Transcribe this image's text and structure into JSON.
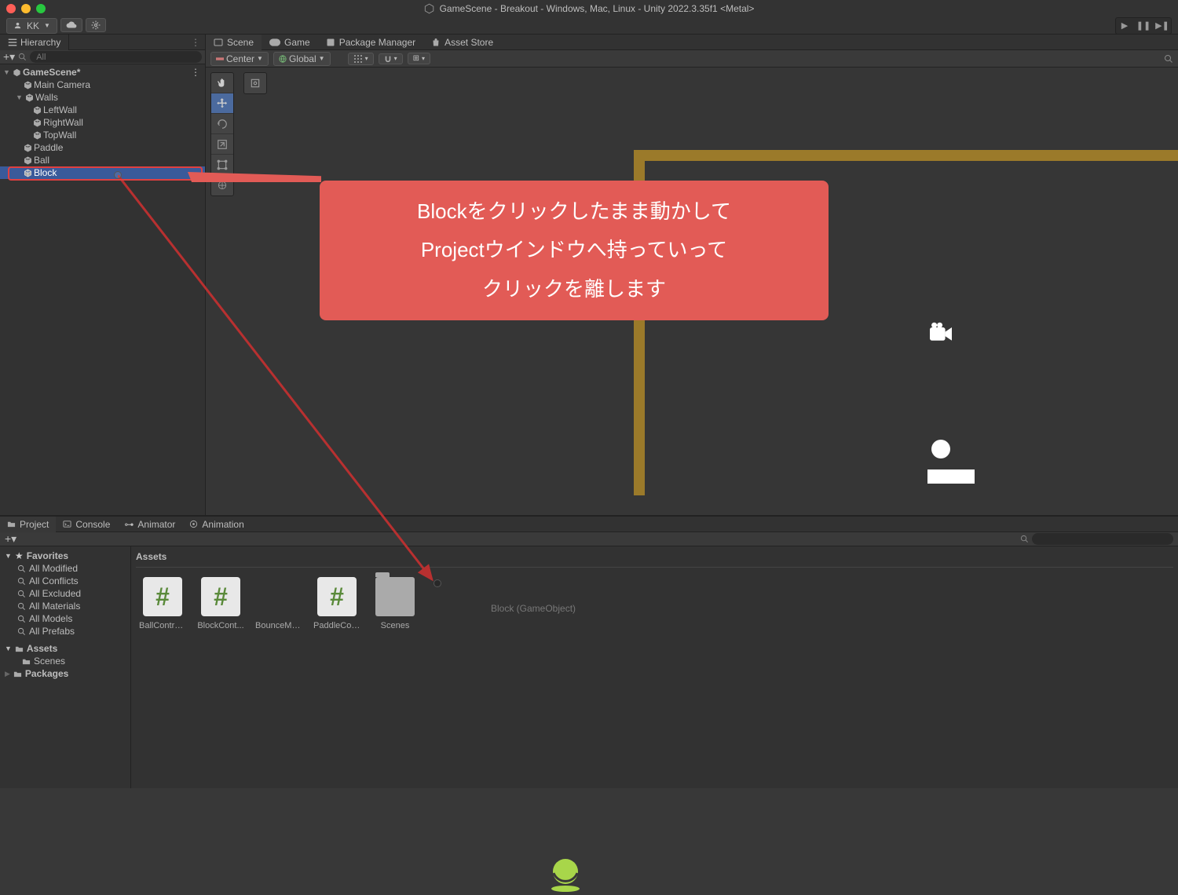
{
  "window": {
    "title": "GameScene - Breakout - Windows, Mac, Linux - Unity 2022.3.35f1 <Metal>"
  },
  "account": {
    "name": "KK"
  },
  "hierarchy": {
    "title": "Hierarchy",
    "search_placeholder": "All",
    "tree": {
      "scene": "GameScene*",
      "items": [
        "Main Camera",
        "Walls",
        "LeftWall",
        "RightWall",
        "TopWall",
        "Paddle",
        "Ball",
        "Block"
      ]
    }
  },
  "scene_tabs": [
    {
      "label": "Scene"
    },
    {
      "label": "Game"
    },
    {
      "label": "Package Manager"
    },
    {
      "label": "Asset Store"
    }
  ],
  "scene_toolbar": {
    "pivot": "Center",
    "space": "Global"
  },
  "project": {
    "tabs": [
      "Project",
      "Console",
      "Animator",
      "Animation"
    ],
    "favorites_label": "Favorites",
    "favorites": [
      "All Modified",
      "All Conflicts",
      "All Excluded",
      "All Materials",
      "All Models",
      "All Prefabs"
    ],
    "assets_label": "Assets",
    "scenes_label": "Scenes",
    "packages_label": "Packages",
    "breadcrumb": "Assets",
    "assets": [
      {
        "name": "BallControl...",
        "type": "script"
      },
      {
        "name": "BlockCont...",
        "type": "script"
      },
      {
        "name": "BounceMa...",
        "type": "material"
      },
      {
        "name": "PaddleCon...",
        "type": "script"
      },
      {
        "name": "Scenes",
        "type": "folder"
      }
    ]
  },
  "drop": {
    "label": "Block (GameObject)"
  },
  "tooltip": {
    "line1": "Blockをクリックしたまま動かして",
    "line2": "Projectウインドウへ持っていって",
    "line3": "クリックを離します"
  }
}
